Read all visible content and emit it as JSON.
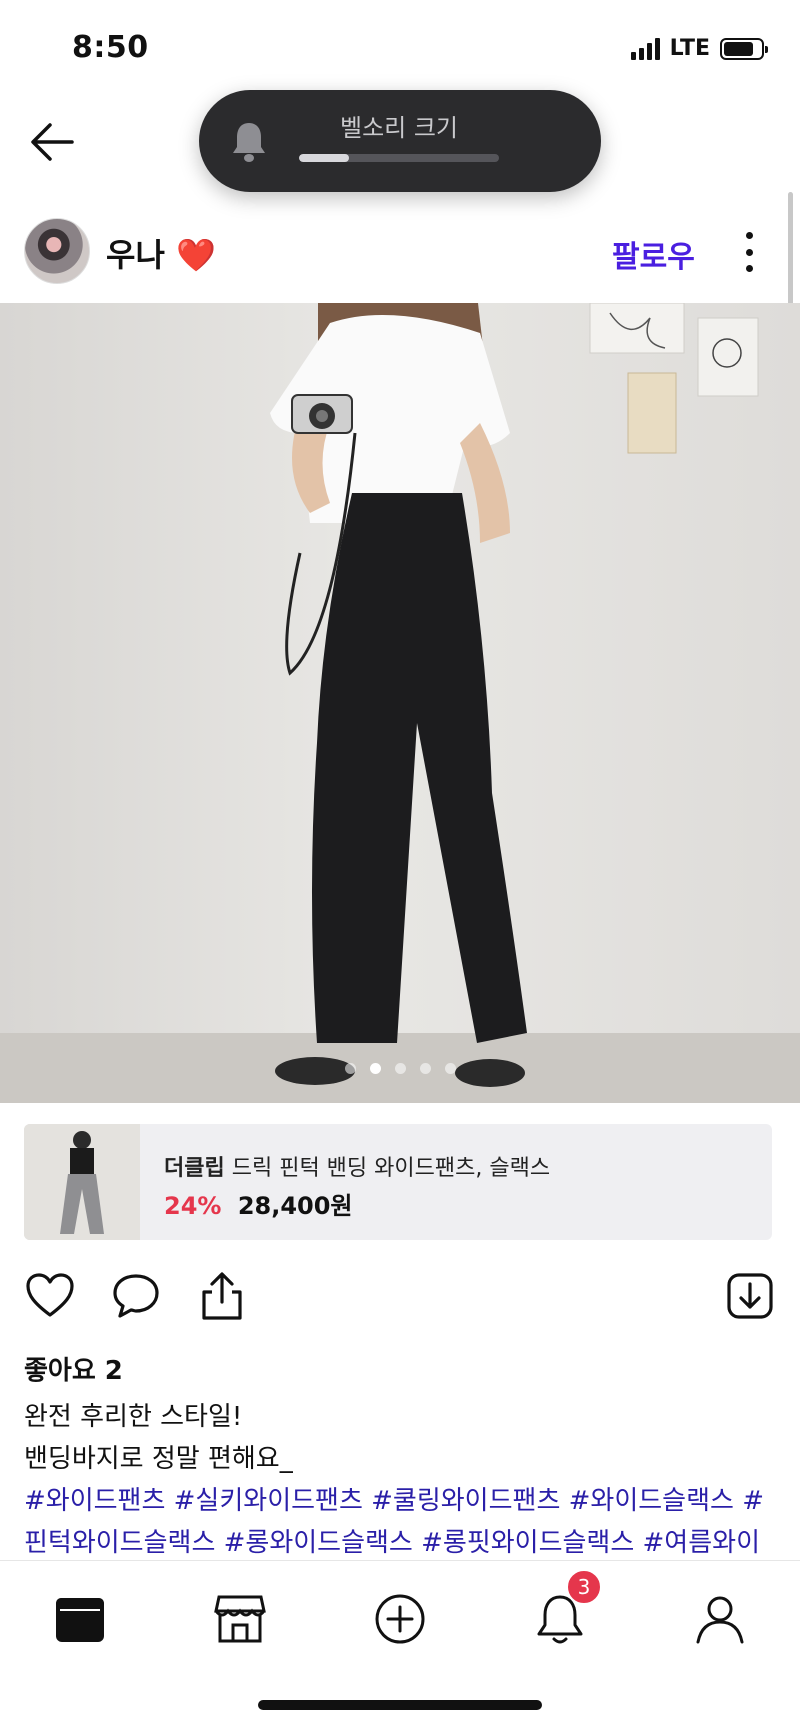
{
  "status_bar": {
    "time": "8:50",
    "network": "LTE"
  },
  "volume_hud": {
    "label": "벨소리 크기",
    "level": 0.25
  },
  "post_header": {
    "username": "우나 ❤️",
    "follow_label": "팔로우"
  },
  "photo": {
    "slide_count": 5,
    "active_index": 1
  },
  "product": {
    "brand": "더클립",
    "name": "드릭 핀턱 밴딩 와이드팬츠, 슬랙스",
    "discount": "24%",
    "price": "28,400원"
  },
  "post": {
    "likes": "좋아요 2",
    "caption_line1": "완전 후리한 스타일!",
    "caption_line2": "밴딩바지로 정말 편해요_",
    "hashtags_line1": "#와이드팬츠 #실키와이드팬츠 #쿨링와이드팬츠 #와이드슬랙스 #",
    "hashtags_line2": "핀턱와이드슬랙스 #롱와이드슬랙스 #롱핏와이드슬랙스 #여름와이"
  },
  "tabbar": {
    "notification_count": "3"
  },
  "colors": {
    "accent": "#4a1fe0",
    "hashtag": "#2a1fa8",
    "discount": "#e5364c",
    "hud_bg": "#2b2b2d"
  },
  "icons": [
    "back-arrow-icon",
    "bell-icon",
    "more-icon",
    "heart-icon",
    "comment-icon",
    "share-icon",
    "download-icon",
    "feed-icon",
    "store-icon",
    "add-icon",
    "notification-icon",
    "profile-icon"
  ]
}
